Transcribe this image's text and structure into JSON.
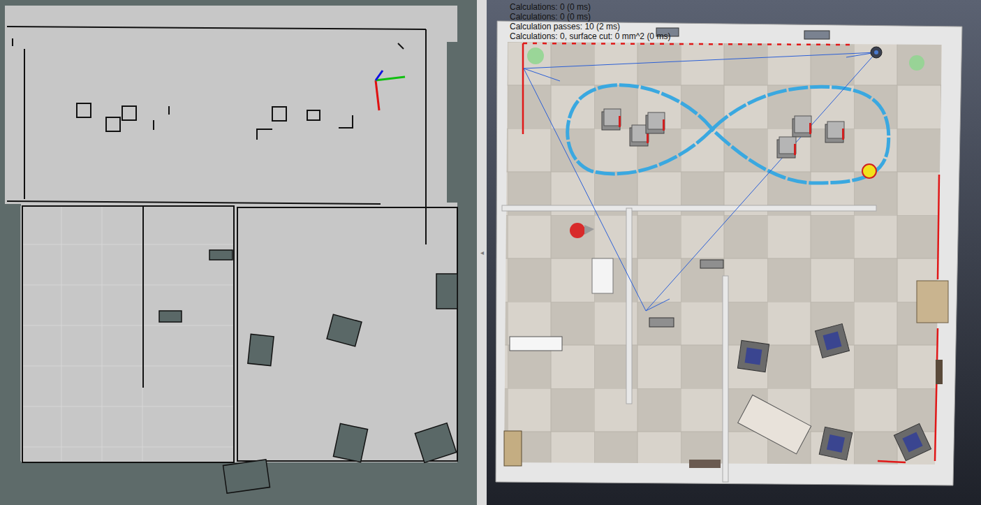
{
  "splitter": {
    "handle": "◂"
  },
  "simulation": {
    "overlay_lines": [
      "Calculations: 0 (0 ms)",
      "Calculations: 0 (0 ms)",
      "Calculation passes: 10 (2 ms)",
      "Calculations: 0, surface cut: 0 mm^2 (0 ms)"
    ]
  }
}
